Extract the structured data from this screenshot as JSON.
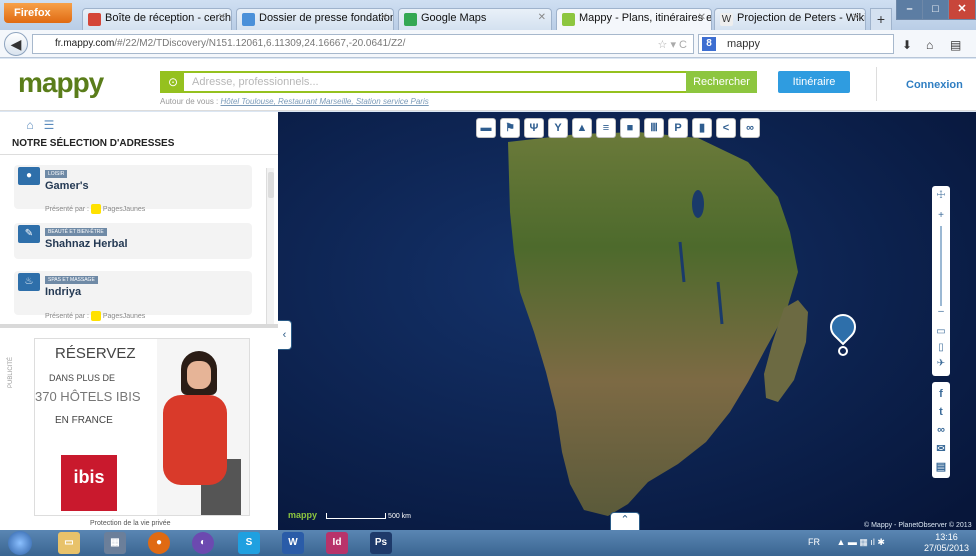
{
  "browser": {
    "app_button": "Firefox",
    "tabs": [
      {
        "title": "Boîte de réception - cerchiariop...",
        "icon": "gmail-icon",
        "color": "#d44638"
      },
      {
        "title": "Dossier de presse fondation edf ...",
        "icon": "doc-icon",
        "color": "#4a90d9"
      },
      {
        "title": "Google Maps",
        "icon": "gmaps-icon",
        "color": "#34a853"
      },
      {
        "title": "Mappy - Plans, itinéraires et bon...",
        "icon": "mappy-icon",
        "color": "#8dc63f"
      },
      {
        "title": "Projection de Peters - Wikipédia",
        "icon": "wikipedia-icon",
        "color": "#555555"
      }
    ],
    "url_host": "fr.mappy.com",
    "url_path": "/#/22/M2/TDiscovery/N151.12061,6.11309,24.16667,-20.0641/Z2/",
    "search_text": "mappy"
  },
  "mappy": {
    "logo": "mappy",
    "search_placeholder": "Adresse, professionnels...",
    "search_button": "Rechercher",
    "itinerary_button": "Itinéraire",
    "login": "Connexion",
    "nearby_prefix": "Autour de vous :",
    "nearby_links": "Hôtel Toulouse, Restaurant Marseille, Station service Paris"
  },
  "panel": {
    "title": "NOTRE SÉLECTION D'ADRESSES",
    "presented_by": "Présenté par :",
    "pj": "PagesJaunes",
    "items": [
      {
        "category": "LOISIR",
        "name": "Gamer's"
      },
      {
        "category": "BEAUTÉ ET BIEN-ÊTRE",
        "name": "Shahnaz Herbal"
      },
      {
        "category": "SPAS ET MASSAGE",
        "name": "Indriya"
      }
    ]
  },
  "ad": {
    "label": "PUBLICITÉ",
    "line1": "RÉSERVEZ",
    "line2": "DANS PLUS DE",
    "line3": "370 HÔTELS IBIS",
    "line4": "EN FRANCE",
    "brand": "ibis",
    "privacy": "Protection de la vie privée"
  },
  "map": {
    "scale_label": "500 km",
    "logo": "mappy",
    "copyright": "© Mappy - PlanetObserver © 2013"
  },
  "taskbar": {
    "lang": "FR",
    "time": "13:16",
    "date": "27/05/2013"
  }
}
